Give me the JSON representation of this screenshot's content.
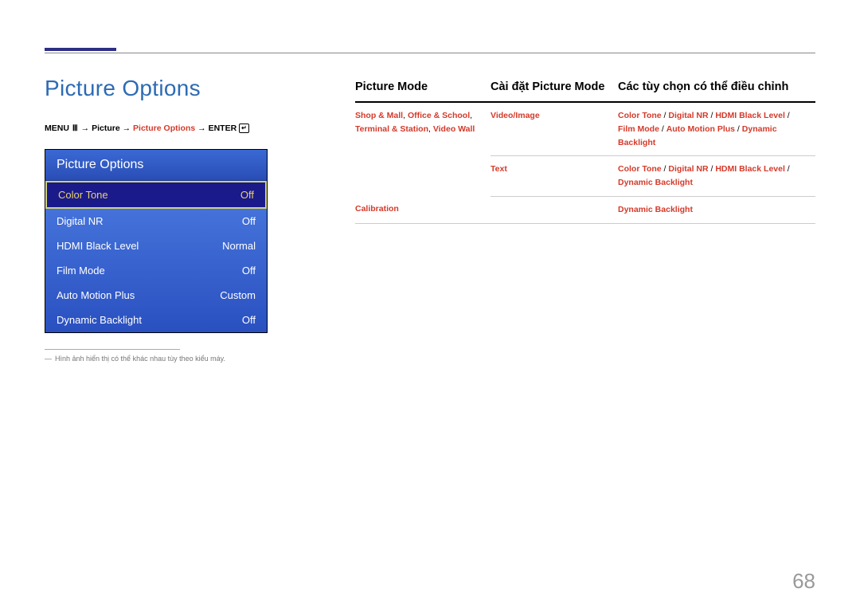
{
  "page_number": "68",
  "page_title": "Picture Options",
  "breadcrumb": {
    "menu": "MENU",
    "path1": "Picture",
    "path2": "Picture Options",
    "enter": "ENTER"
  },
  "menu_panel": {
    "title": "Picture Options",
    "items": [
      {
        "label": "Color Tone",
        "value": "Off",
        "selected": true
      },
      {
        "label": "Digital NR",
        "value": "Off",
        "selected": false
      },
      {
        "label": "HDMI Black Level",
        "value": "Normal",
        "selected": false
      },
      {
        "label": "Film Mode",
        "value": "Off",
        "selected": false
      },
      {
        "label": "Auto Motion Plus",
        "value": "Custom",
        "selected": false
      },
      {
        "label": "Dynamic Backlight",
        "value": "Off",
        "selected": false
      }
    ]
  },
  "footnote": "Hình ảnh hiển thị có thể khác nhau tùy theo kiểu máy.",
  "table": {
    "headers": [
      "Picture Mode",
      "Cài đặt Picture Mode",
      "Các tùy chọn có thể điều chỉnh"
    ],
    "rows": [
      {
        "col1_parts": [
          {
            "text": "Shop & Mall",
            "red": true
          },
          {
            "text": ", "
          },
          {
            "text": "Office & School",
            "red": true
          },
          {
            "text": ", "
          },
          {
            "text": "Terminal & Station",
            "red": true
          },
          {
            "text": ", "
          },
          {
            "text": "Video Wall",
            "red": true
          }
        ],
        "sub": [
          {
            "col2": "Video/Image",
            "col3_parts": [
              {
                "text": "Color Tone",
                "red": true
              },
              {
                "text": " / "
              },
              {
                "text": "Digital NR",
                "red": true
              },
              {
                "text": " / "
              },
              {
                "text": "HDMI Black Level",
                "red": true
              },
              {
                "text": " / "
              },
              {
                "text": "Film Mode",
                "red": true
              },
              {
                "text": " / "
              },
              {
                "text": "Auto Motion Plus",
                "red": true
              },
              {
                "text": " / "
              },
              {
                "text": "Dynamic Backlight",
                "red": true
              }
            ]
          },
          {
            "col2": "Text",
            "col3_parts": [
              {
                "text": "Color Tone",
                "red": true
              },
              {
                "text": " / "
              },
              {
                "text": "Digital NR",
                "red": true
              },
              {
                "text": " / "
              },
              {
                "text": "HDMI Black Level",
                "red": true
              },
              {
                "text": " / "
              },
              {
                "text": "Dynamic Backlight",
                "red": true
              }
            ]
          }
        ]
      },
      {
        "col1_parts": [
          {
            "text": "Calibration",
            "red": true
          }
        ],
        "sub": [
          {
            "col2": "",
            "col3_parts": [
              {
                "text": "Dynamic Backlight",
                "red": true
              }
            ]
          }
        ]
      }
    ]
  }
}
